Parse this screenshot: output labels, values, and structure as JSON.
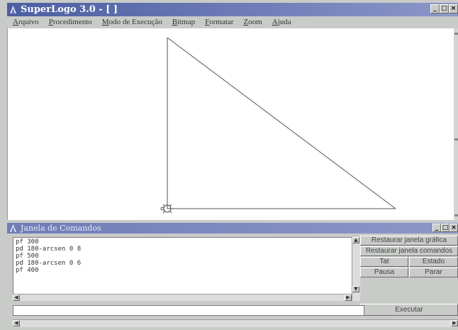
{
  "window": {
    "title": "SuperLogo 3.0 - [ ]",
    "controls": [
      "_",
      "□",
      "×"
    ]
  },
  "menu": [
    "Arquivo",
    "Procedimento",
    "Modo de Execução",
    "Bitmap",
    "Formatar",
    "Zoom",
    "Ajuda"
  ],
  "command_window": {
    "title": "Janela de Comandos",
    "history": [
      "pf 300",
      "pd 180-arcsen 0 8",
      "pf 500",
      "pd 180-arcsen 0 6",
      "pf 400"
    ],
    "input_value": ""
  },
  "buttons": {
    "restore_graphic": "Restaurar janela gráfica",
    "restore_commands": "Restaurar janela comandos",
    "tat": "Tat",
    "estado": "Estado",
    "pausa": "Pausa",
    "parar": "Parar",
    "executar": "Executar"
  },
  "colors": {
    "title_bar": "#4b5ea1",
    "canvas": "#ffffff",
    "drawing": "#555555"
  }
}
